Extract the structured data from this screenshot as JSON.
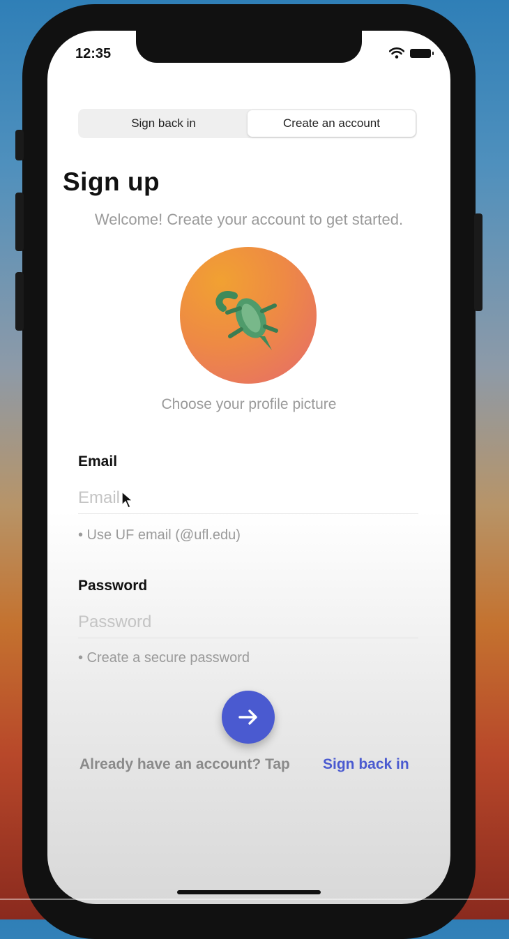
{
  "status_bar": {
    "time": "12:35"
  },
  "segmented_control": {
    "options": [
      {
        "label": "Sign back in",
        "selected": false
      },
      {
        "label": "Create an account",
        "selected": true
      }
    ]
  },
  "header": {
    "title": "Sign up",
    "subtitle": "Welcome! Create your account to get started."
  },
  "profile": {
    "caption": "Choose your profile picture",
    "icon": "alligator-icon"
  },
  "form": {
    "email": {
      "label": "Email",
      "placeholder": "Email",
      "value": "",
      "hint": "• Use UF email (@ufl.edu)"
    },
    "password": {
      "label": "Password",
      "placeholder": "Password",
      "value": "",
      "hint": "• Create a secure password"
    },
    "submit_icon": "arrow-right-icon"
  },
  "footer": {
    "text": "Already have an account? Tap",
    "link": "Sign back in"
  },
  "colors": {
    "accent": "#4a5ad0",
    "avatar_gradient_start": "#f1a132",
    "avatar_gradient_end": "#e56a6c"
  }
}
